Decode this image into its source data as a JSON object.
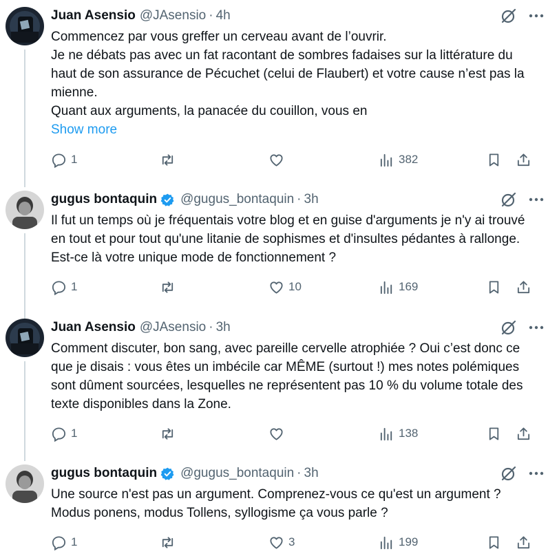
{
  "tweets": [
    {
      "author": "Juan Asensio",
      "handle": "@JAsensio",
      "dot": "·",
      "time": "4h",
      "verified": false,
      "lines": [
        "Commencez par vous greffer un cerveau avant de l’ouvrir.",
        "Je ne débats pas avec un fat racontant de sombres fadaises sur la littérature du haut de son assurance de Pécuchet (celui de Flaubert) et votre cause n’est pas la mienne.",
        "Quant aux arguments, la panacée du couillon, vous en"
      ],
      "show_more": "Show more",
      "replies": "1",
      "retweets": "",
      "likes": "",
      "views": "382"
    },
    {
      "author": "gugus bontaquin",
      "handle": "@gugus_bontaquin",
      "dot": "·",
      "time": "3h",
      "verified": true,
      "lines": [
        "Il fut un temps où je fréquentais votre blog et en guise d'arguments je n'y ai trouvé en tout et pour tout qu'une litanie de sophismes et d'insultes pédantes à rallonge. Est-ce là votre unique mode de fonctionnement ?"
      ],
      "replies": "1",
      "retweets": "",
      "likes": "10",
      "views": "169"
    },
    {
      "author": "Juan Asensio",
      "handle": "@JAsensio",
      "dot": "·",
      "time": "3h",
      "verified": false,
      "lines": [
        "Comment discuter, bon sang, avec pareille cervelle atrophiée ? Oui c’est donc ce que je disais : vous êtes un imbécile car MÊME (surtout !) mes notes polémiques sont dûment sourcées, lesquelles ne représentent pas 10 % du volume totale des texte disponibles dans la Zone."
      ],
      "replies": "1",
      "retweets": "",
      "likes": "",
      "views": "138"
    },
    {
      "author": "gugus bontaquin",
      "handle": "@gugus_bontaquin",
      "dot": "·",
      "time": "3h",
      "verified": true,
      "lines": [
        "Une source n'est pas un argument. Comprenez-vous ce qu'est un argument ? Modus ponens, modus Tollens, syllogisme ça vous parle ?"
      ],
      "replies": "1",
      "retweets": "",
      "likes": "3",
      "views": "199"
    }
  ],
  "icons": {
    "grok": "grok-icon",
    "more": "more-icon",
    "reply": "reply-icon",
    "retweet": "retweet-icon",
    "like": "heart-icon",
    "views": "views-icon",
    "bookmark": "bookmark-icon",
    "share": "share-icon"
  },
  "colors": {
    "text": "#0f1419",
    "muted": "#536471",
    "link": "#1d9bf0",
    "verified": "#1d9bf0",
    "thread_line": "#cfd9de"
  }
}
